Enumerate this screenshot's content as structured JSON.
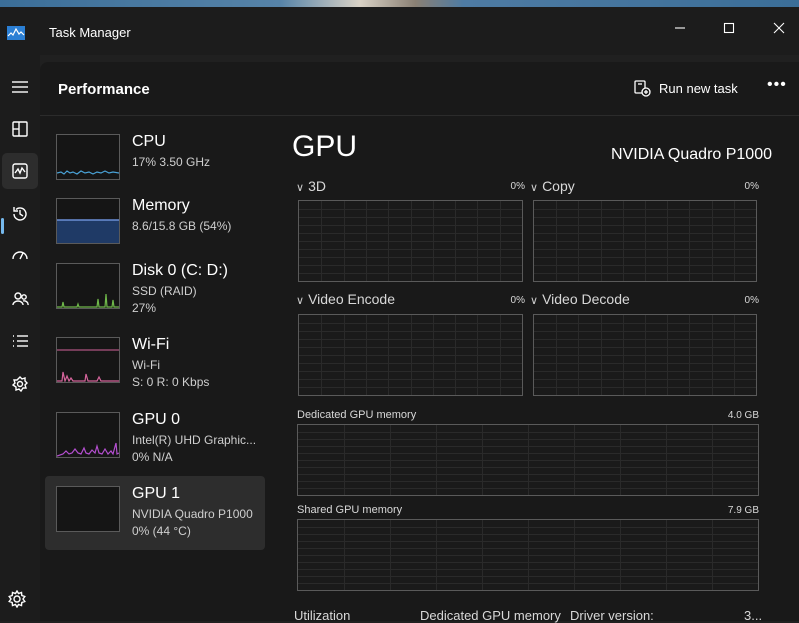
{
  "window": {
    "title": "Task Manager"
  },
  "nav": {
    "items": [
      {
        "name": "hamburger-menu-icon"
      },
      {
        "name": "processes-icon"
      },
      {
        "name": "performance-icon"
      },
      {
        "name": "app-history-icon"
      },
      {
        "name": "startup-apps-icon"
      },
      {
        "name": "users-icon"
      },
      {
        "name": "details-icon"
      },
      {
        "name": "services-icon"
      }
    ],
    "settings_icon": "gear-icon"
  },
  "header": {
    "title": "Performance",
    "run_task_label": "Run new task",
    "more_label": "•••"
  },
  "devices": [
    {
      "title": "CPU",
      "line1": "17%  3.50 GHz",
      "line2": ""
    },
    {
      "title": "Memory",
      "line1": "8.6/15.8 GB (54%)",
      "line2": ""
    },
    {
      "title": "Disk 0 (C: D:)",
      "line1": "SSD (RAID)",
      "line2": "27%"
    },
    {
      "title": "Wi-Fi",
      "line1": "Wi-Fi",
      "line2": "S: 0  R: 0 Kbps"
    },
    {
      "title": "GPU 0",
      "line1": "Intel(R) UHD Graphic...",
      "line2": "0%  N/A"
    },
    {
      "title": "GPU 1",
      "line1": "NVIDIA Quadro P1000",
      "line2": "0%  (44 °C)"
    }
  ],
  "detail": {
    "title": "GPU",
    "model": "NVIDIA Quadro P1000",
    "engines": [
      {
        "label": "3D",
        "percent": "0%"
      },
      {
        "label": "Copy",
        "percent": "0%"
      },
      {
        "label": "Video Encode",
        "percent": "0%"
      },
      {
        "label": "Video Decode",
        "percent": "0%"
      }
    ],
    "dedicated_memory": {
      "label": "Dedicated GPU memory",
      "max": "4.0 GB"
    },
    "shared_memory": {
      "label": "Shared GPU memory",
      "max": "7.9 GB"
    },
    "footer": {
      "utilization": "Utilization",
      "dedicated": "Dedicated GPU memory",
      "driver": "Driver version:",
      "driver_value": "3..."
    }
  },
  "colors": {
    "accent": "#76b9ed",
    "cpu": "#4aa3d8",
    "memory": "#6b8fd6",
    "disk": "#6fb84a",
    "wifi": "#d4649b",
    "gpu": "#b44fd0"
  }
}
